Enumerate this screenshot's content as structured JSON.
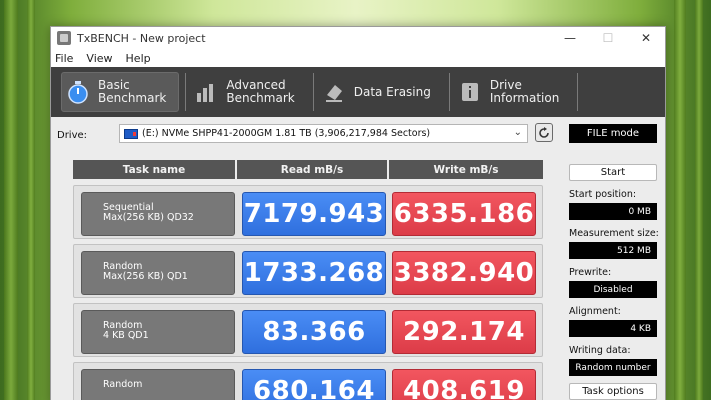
{
  "window": {
    "title": "TxBENCH - New project",
    "controls": {
      "minimize": "—",
      "maximize": "☐",
      "close": "✕"
    }
  },
  "menu": [
    "File",
    "View",
    "Help"
  ],
  "toolbar": {
    "buttons": [
      {
        "label": "Basic\nBenchmark",
        "icon": "stopwatch-icon",
        "active": true
      },
      {
        "label": "Advanced\nBenchmark",
        "icon": "bar-chart-icon",
        "active": false
      },
      {
        "label": "Data Erasing",
        "icon": "eraser-icon",
        "active": false
      },
      {
        "label": "Drive\nInformation",
        "icon": "info-icon",
        "active": false
      }
    ]
  },
  "drive": {
    "label": "Drive:",
    "selected": "(E:) NVMe SHPP41-2000GM  1.81 TB (3,906,217,984 Sectors)"
  },
  "mode": "FILE mode",
  "table": {
    "headers": [
      "Task name",
      "Read mB/s",
      "Write mB/s"
    ],
    "rows": [
      {
        "task": "Sequential\nMax(256 KB) QD32",
        "read": "7179.943",
        "write": "6335.186"
      },
      {
        "task": "Random\nMax(256 KB) QD1",
        "read": "1733.268",
        "write": "3382.940"
      },
      {
        "task": "Random\n4 KB QD1",
        "read": "83.366",
        "write": "292.174"
      },
      {
        "task": "Random",
        "read": "680.164",
        "write": "408.619"
      }
    ]
  },
  "side": {
    "start_label": "Start",
    "start_position_label": "Start position:",
    "start_position": "0 MB",
    "measurement_size_label": "Measurement size:",
    "measurement_size": "512 MB",
    "prewrite_label": "Prewrite:",
    "prewrite": "Disabled",
    "alignment_label": "Alignment:",
    "alignment": "4 KB",
    "writing_data_label": "Writing data:",
    "writing_data": "Random number",
    "task_options_label": "Task options"
  },
  "colors": {
    "read": "#3a7ff0",
    "write": "#e5474f",
    "toolbar": "#3f3f3f"
  }
}
